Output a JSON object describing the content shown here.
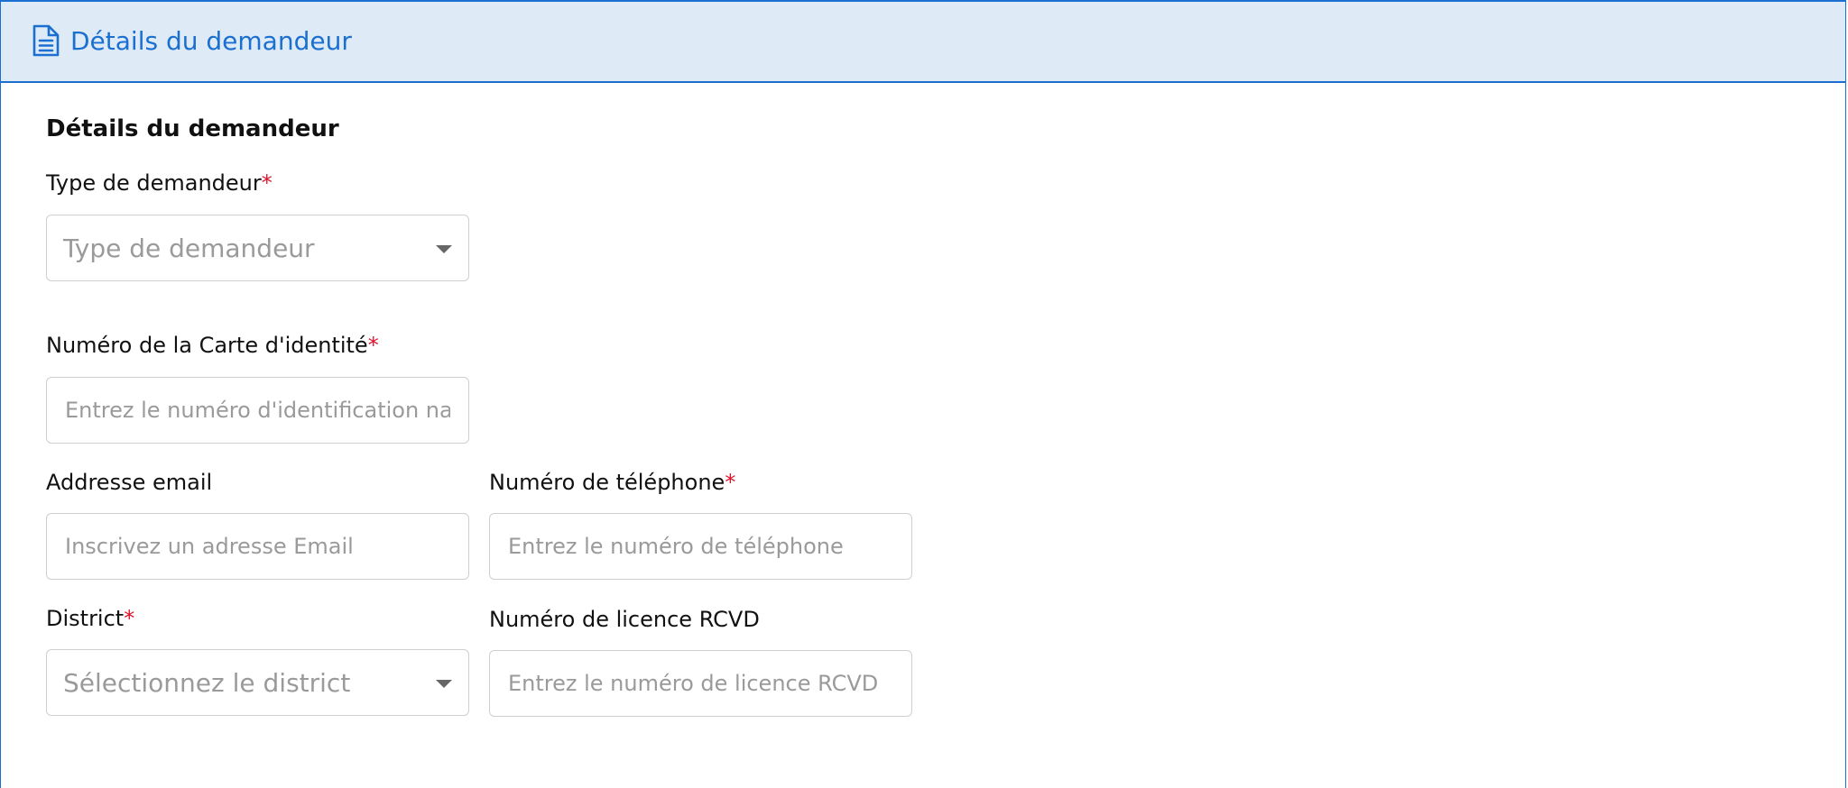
{
  "header": {
    "icon": "document-icon",
    "title": "Détails du demandeur"
  },
  "section": {
    "title": "Détails du demandeur"
  },
  "fields": {
    "applicant_type": {
      "label": "Type de demandeur",
      "required_mark": "*",
      "selected": "Type de demandeur"
    },
    "id_number": {
      "label": "Numéro de la Carte d'identité",
      "required_mark": "*",
      "placeholder": "Entrez le numéro d'identification national"
    },
    "email": {
      "label": "Addresse email",
      "placeholder": "Inscrivez un adresse Email"
    },
    "phone": {
      "label": "Numéro de téléphone",
      "required_mark": "*",
      "placeholder": "Entrez le numéro de téléphone"
    },
    "district": {
      "label": "District",
      "required_mark": "*",
      "selected": "Sélectionnez le district"
    },
    "rcvd_license": {
      "label": "Numéro de licence RCVD",
      "placeholder": "Entrez le numéro de licence RCVD"
    }
  },
  "colors": {
    "accent": "#1a6fd0",
    "header_bg": "#deebf7",
    "required": "#e0112b",
    "placeholder": "#9a9a9a"
  }
}
